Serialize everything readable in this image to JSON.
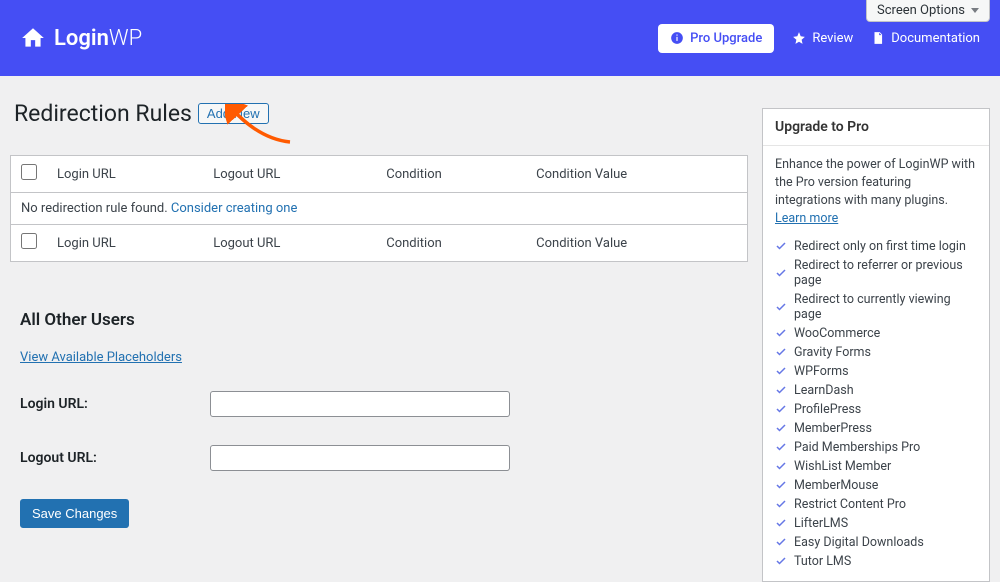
{
  "screen_options": "Screen Options",
  "brand_name": "Login",
  "brand_suffix": "WP",
  "top_actions": {
    "pro": "Pro Upgrade",
    "review": "Review",
    "docs": "Documentation"
  },
  "page_title": "Redirection Rules",
  "add_new": "Add New",
  "table": {
    "headers": {
      "login_url": "Login URL",
      "logout_url": "Logout URL",
      "condition": "Condition",
      "condition_value": "Condition Value"
    },
    "empty_text": "No redirection rule found. ",
    "empty_link": "Consider creating one"
  },
  "other_users": {
    "title": "All Other Users",
    "placeholders_link": "View Available Placeholders",
    "login_label": "Login URL:",
    "login_value": "",
    "logout_label": "Logout URL:",
    "logout_value": "",
    "save": "Save Changes"
  },
  "probox": {
    "title": "Upgrade to Pro",
    "desc": "Enhance the power of LoginWP with the Pro version featuring integrations with many plugins. ",
    "learn": "Learn more",
    "features": [
      "Redirect only on first time login",
      "Redirect to referrer or previous page",
      "Redirect to currently viewing page",
      "WooCommerce",
      "Gravity Forms",
      "WPForms",
      "LearnDash",
      "ProfilePress",
      "MemberPress",
      "Paid Memberships Pro",
      "WishList Member",
      "MemberMouse",
      "Restrict Content Pro",
      "LifterLMS",
      "Easy Digital Downloads",
      "Tutor LMS"
    ]
  }
}
